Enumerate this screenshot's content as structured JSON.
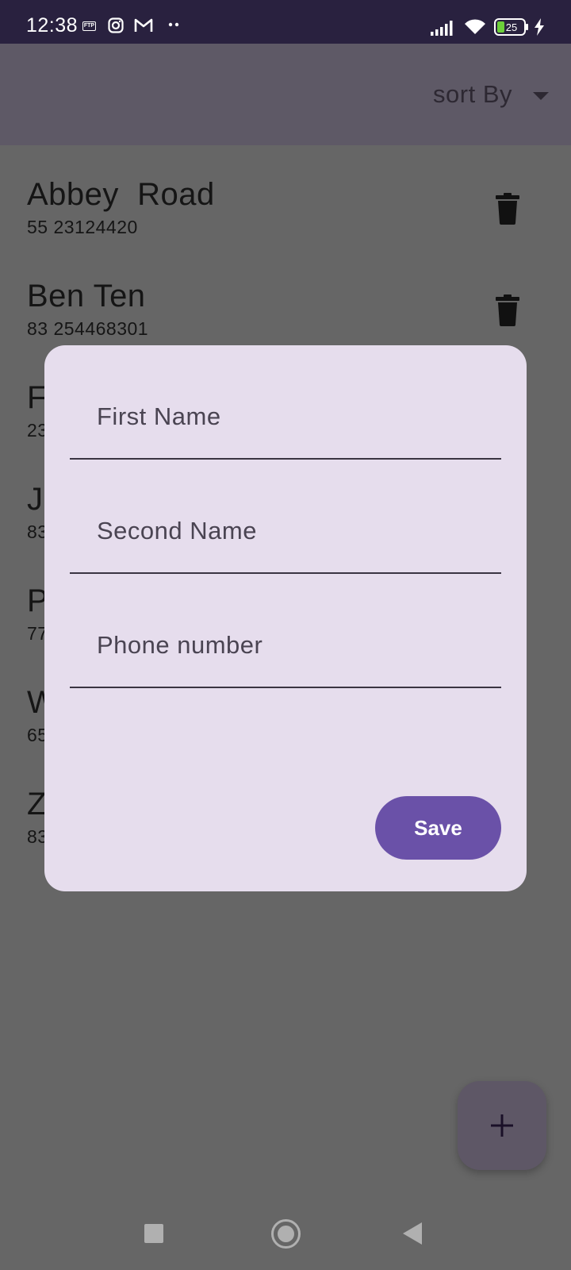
{
  "status_bar": {
    "time": "12:38",
    "ftp_label": "FTP",
    "battery_level": "25",
    "icons": [
      "ftp-icon",
      "instagram-icon",
      "gmail-icon",
      "more-dots-icon",
      "signal-icon",
      "wifi-icon",
      "battery-icon",
      "charging-icon"
    ]
  },
  "app_bar": {
    "sort_label": "sort By"
  },
  "contacts": [
    {
      "name": "Abbey  Road",
      "phone": "55 23124420"
    },
    {
      "name": "Ben Ten",
      "phone": "83 254468301"
    },
    {
      "name": "F",
      "phone": "23"
    },
    {
      "name": "J",
      "phone": "83"
    },
    {
      "name": "P",
      "phone": "77"
    },
    {
      "name": "W",
      "phone": "65"
    },
    {
      "name": "Z",
      "phone": "83"
    }
  ],
  "dialog": {
    "first_name_label": "First Name",
    "second_name_label": "Second Name",
    "phone_label": "Phone number",
    "save_label": "Save"
  },
  "colors": {
    "status_bar": "#29213f",
    "app_bar": "#5e5966",
    "scrim_background": "#666666",
    "dialog_background": "#e6dded",
    "save_button": "#6a51a8",
    "fab": "#5e5766"
  }
}
